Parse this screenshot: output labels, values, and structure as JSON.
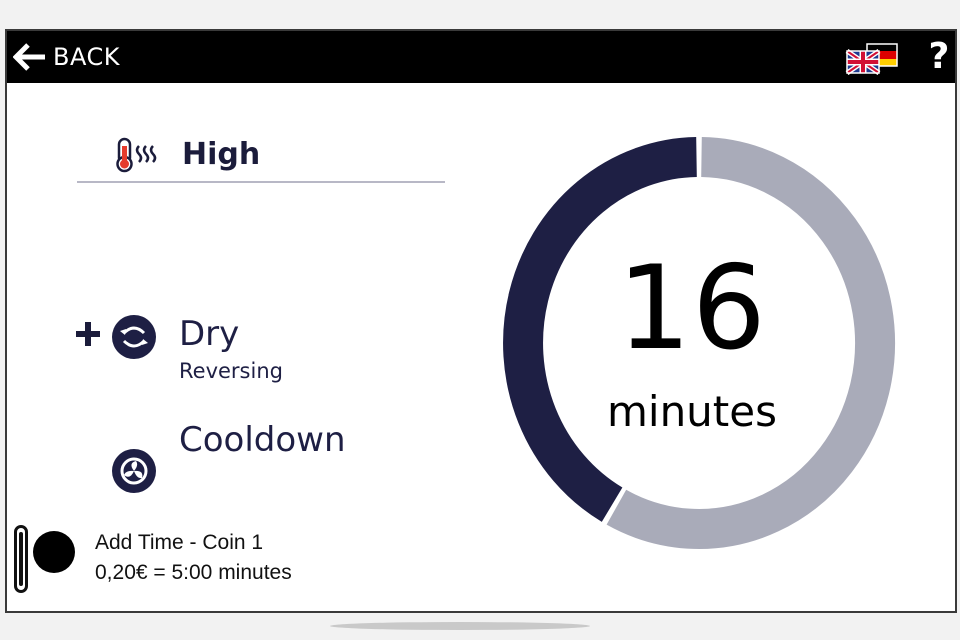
{
  "header": {
    "back_label": "BACK",
    "help_label": "?",
    "language_icon": "uk-germany-flags-icon"
  },
  "heat": {
    "label": "High",
    "icon": "thermometer-heat-icon"
  },
  "program": {
    "add_icon": "plus-icon",
    "dry": {
      "title": "Dry",
      "subtitle": "Reversing",
      "icon": "reversing-drum-icon"
    },
    "cooldown": {
      "title": "Cooldown",
      "icon": "fan-icon"
    }
  },
  "timer": {
    "value": "16",
    "unit": "minutes",
    "elapsed_fraction": 0.42,
    "colors": {
      "elapsed": "#1e1f44",
      "remaining": "#a9abb9"
    }
  },
  "coin": {
    "line1": "Add Time - Coin 1",
    "line2": "0,20€ = 5:00 minutes",
    "icon": "coin-icon"
  }
}
